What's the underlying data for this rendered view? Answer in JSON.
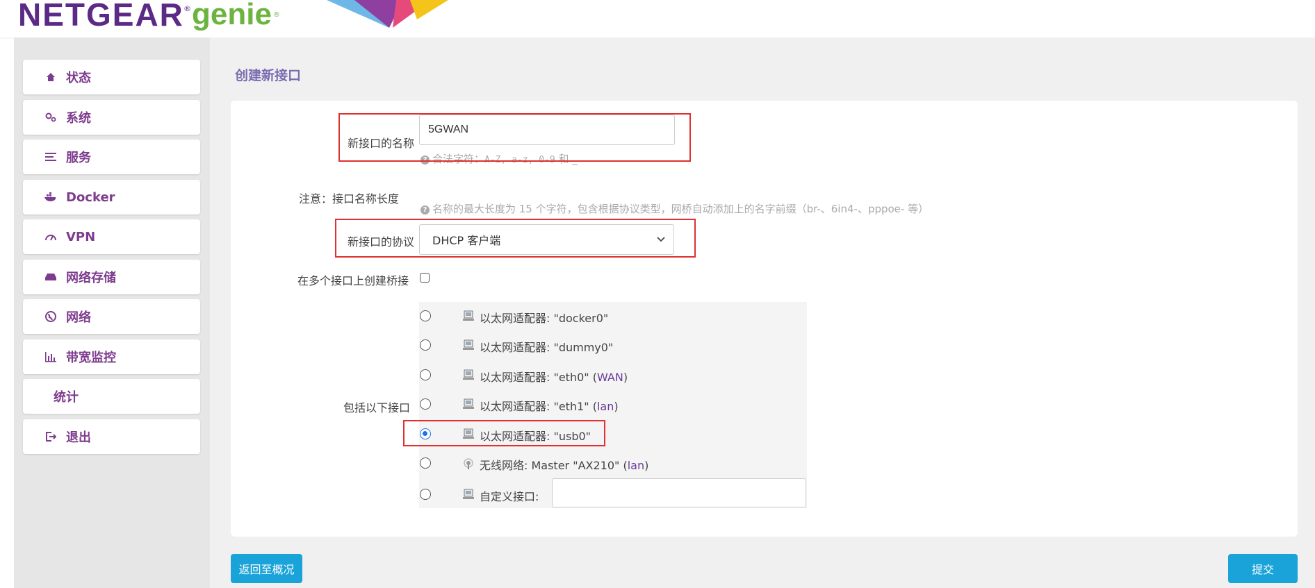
{
  "header": {
    "logo_brand": "NETGEAR",
    "logo_product": "genie",
    "registered_mark": "®"
  },
  "sidebar": {
    "items": [
      {
        "label": "状态",
        "icon": "home-icon"
      },
      {
        "label": "系统",
        "icon": "gears-icon"
      },
      {
        "label": "服务",
        "icon": "list-icon"
      },
      {
        "label": "Docker",
        "icon": "docker-icon"
      },
      {
        "label": "VPN",
        "icon": "gauge-icon"
      },
      {
        "label": "网络存储",
        "icon": "drive-icon"
      },
      {
        "label": "网络",
        "icon": "globe-icon"
      },
      {
        "label": "带宽监控",
        "icon": "bar-chart-icon"
      },
      {
        "label": "统计",
        "icon": ""
      },
      {
        "label": "退出",
        "icon": "logout-icon"
      }
    ]
  },
  "main": {
    "title": "创建新接口",
    "form": {
      "name_label": "新接口的名称",
      "name_value": "5GWAN",
      "name_hint_prefix": "合法字符：",
      "name_hint_chars": "A-Z, a-z, 0-9",
      "name_hint_suffix": " 和 _",
      "note_label": "注意：接口名称长度",
      "note_hint": "名称的最大长度为 15 个字符，包含根据协议类型，网桥自动添加上的名字前缀（br-、6in4-、pppoe- 等）",
      "protocol_label": "新接口的协议",
      "protocol_value": "DHCP 客户端",
      "bridge_label": "在多个接口上创建桥接",
      "bridge_checked": false,
      "include_label": "包括以下接口",
      "interfaces": [
        {
          "text": "以太网适配器: \"docker0\"",
          "zone": "",
          "checked": false,
          "icon": "ethernet-adapter-icon"
        },
        {
          "text": "以太网适配器: \"dummy0\"",
          "zone": "",
          "checked": false,
          "icon": "ethernet-adapter-icon"
        },
        {
          "text": "以太网适配器: \"eth0\" (",
          "zone": "WAN",
          "checked": false,
          "icon": "ethernet-adapter-icon"
        },
        {
          "text": "以太网适配器: \"eth1\" (",
          "zone": "lan",
          "checked": false,
          "icon": "ethernet-adapter-icon"
        },
        {
          "text": "以太网适配器: \"usb0\"",
          "zone": "",
          "checked": true,
          "icon": "ethernet-adapter-icon"
        },
        {
          "text": "无线网络: Master \"AX210\" (",
          "zone": "lan",
          "checked": false,
          "icon": "wireless-icon"
        },
        {
          "text": "自定义接口:",
          "zone": "",
          "checked": false,
          "icon": "ethernet-adapter-icon"
        }
      ],
      "custom_interface_value": ""
    },
    "buttons": {
      "back": "返回至概况",
      "submit": "提交"
    }
  },
  "colors": {
    "brand_purple": "#5b2a86",
    "brand_green": "#6cb33f",
    "nav_text": "#7d3c8e",
    "title": "#7a6cb0",
    "button": "#1aa3d9",
    "highlight": "#e03030",
    "radio_checked": "#1a73e8"
  }
}
